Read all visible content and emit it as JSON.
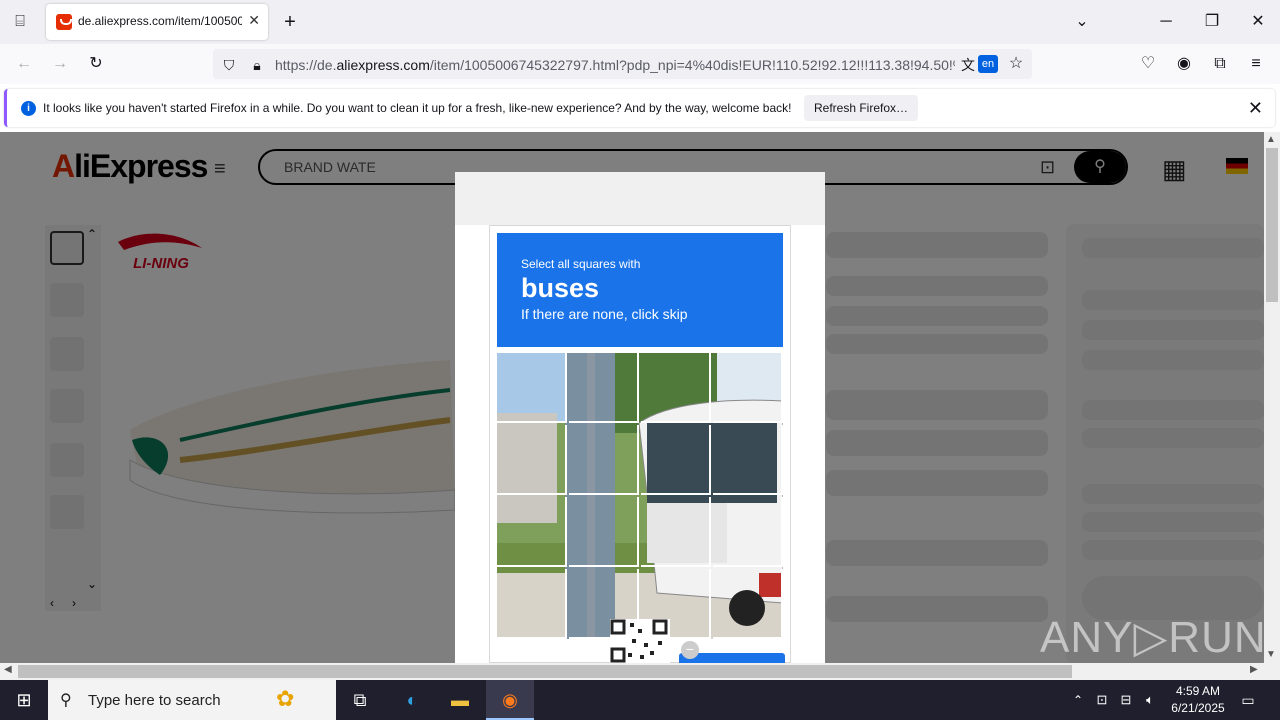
{
  "browser": {
    "tab_title": "de.aliexpress.com/item/100500",
    "url_prefix": "https://de.",
    "url_domain": "aliexpress.com",
    "url_rest": "/item/1005006745322797.html?pdp_npi=4%40dis!EUR!110.52!92.12!!!113.38!94.50!%4",
    "translate_label": "en"
  },
  "notification": {
    "message": "It looks like you haven't started Firefox in a while. Do you want to clean it up for a fresh, like-new experience? And by the way, welcome back!",
    "button": "Refresh Firefox…"
  },
  "site": {
    "logo_a": "A",
    "logo_rest": "liExpress",
    "search_text": "BRAND WATE",
    "brand": "LI-NING"
  },
  "captcha": {
    "line1": "Select all squares with",
    "target": "buses",
    "line3": "If there are none, click skip"
  },
  "watermark": "ANY▷RUN",
  "taskbar": {
    "search_placeholder": "Type here to search",
    "time": "4:59 AM",
    "date": "6/21/2025"
  }
}
